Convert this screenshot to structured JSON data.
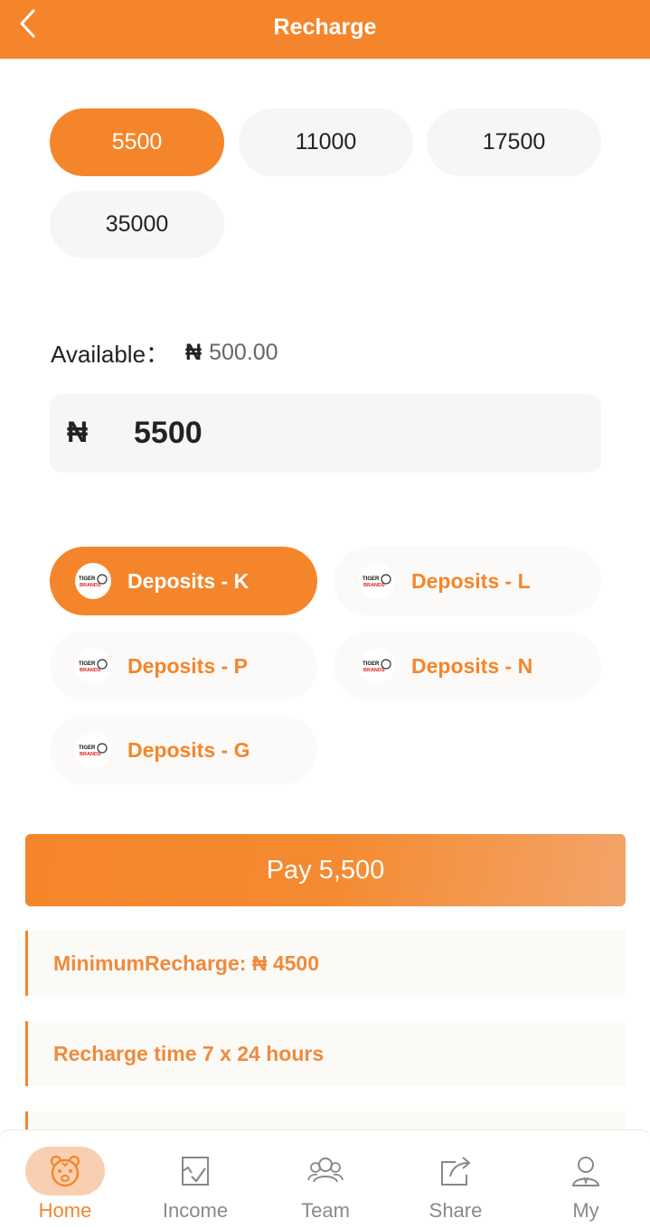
{
  "header": {
    "title": "Recharge"
  },
  "amount_options": [
    {
      "label": "5500",
      "selected": true
    },
    {
      "label": "11000",
      "selected": false
    },
    {
      "label": "17500",
      "selected": false
    },
    {
      "label": "35000",
      "selected": false
    }
  ],
  "available": {
    "label": "Available：",
    "currency": "₦",
    "value": "500.00"
  },
  "amount_input": {
    "currency": "₦",
    "value": "5500"
  },
  "channels": [
    {
      "label": "Deposits - K",
      "selected": true
    },
    {
      "label": "Deposits - L",
      "selected": false
    },
    {
      "label": "Deposits - P",
      "selected": false
    },
    {
      "label": "Deposits - N",
      "selected": false
    },
    {
      "label": "Deposits - G",
      "selected": false
    }
  ],
  "logo_text": [
    "TIGER",
    "BRANDS"
  ],
  "pay_button": {
    "label": "Pay 5,500"
  },
  "notes": [
    "MinimumRecharge: ₦ 4500",
    "Recharge time 7 x 24 hours"
  ],
  "nav": [
    {
      "label": "Home",
      "icon": "tiger-icon",
      "active": true
    },
    {
      "label": "Income",
      "icon": "income-icon",
      "active": false
    },
    {
      "label": "Team",
      "icon": "team-icon",
      "active": false
    },
    {
      "label": "Share",
      "icon": "share-icon",
      "active": false
    },
    {
      "label": "My",
      "icon": "user-icon",
      "active": false
    }
  ],
  "colors": {
    "accent": "#f5852a",
    "chip_bg": "#f6f6f6",
    "note_text": "#f08a3c"
  }
}
